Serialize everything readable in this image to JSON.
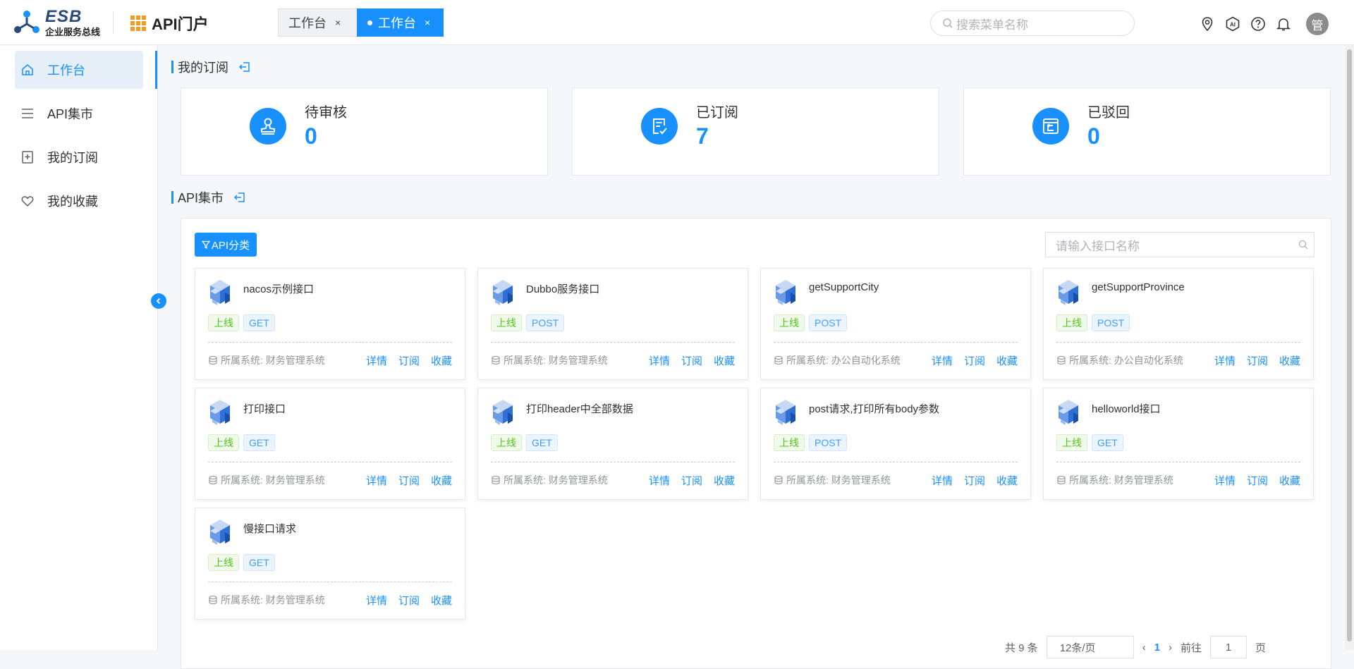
{
  "brand": {
    "logo_title": "ESB",
    "logo_subtitle": "企业服务总线",
    "portal_title": "API门户"
  },
  "tabs": [
    {
      "label": "工作台",
      "active": false
    },
    {
      "label": "工作台",
      "active": true
    }
  ],
  "header": {
    "search_placeholder": "搜索菜单名称",
    "avatar_text": "管",
    "icons": [
      "location-icon",
      "ai-icon",
      "help-icon",
      "bell-icon"
    ]
  },
  "sidebar": {
    "items": [
      {
        "label": "工作台",
        "icon": "home-icon",
        "active": true
      },
      {
        "label": "API集市",
        "icon": "list-icon"
      },
      {
        "label": "我的订阅",
        "icon": "subscription-icon"
      },
      {
        "label": "我的收藏",
        "icon": "heart-icon"
      }
    ]
  },
  "subscription": {
    "title": "我的订阅",
    "stats": [
      {
        "label": "待审核",
        "value": "0",
        "icon": "stamp-icon"
      },
      {
        "label": "已订阅",
        "value": "7",
        "icon": "checklist-icon"
      },
      {
        "label": "已驳回",
        "value": "0",
        "icon": "return-icon"
      }
    ]
  },
  "market": {
    "title": "API集市",
    "category_button": "API分类",
    "search_placeholder": "请输入接口名称",
    "system_prefix": "所属系统: ",
    "actions": {
      "detail": "详情",
      "subscribe": "订阅",
      "favorite": "收藏"
    },
    "cards": [
      {
        "name": "nacos示例接口",
        "status": "上线",
        "method": "GET",
        "system": "财务管理系统"
      },
      {
        "name": "Dubbo服务接口",
        "status": "上线",
        "method": "POST",
        "system": "财务管理系统"
      },
      {
        "name": "getSupportCity",
        "status": "上线",
        "method": "POST",
        "system": "办公自动化系统"
      },
      {
        "name": "getSupportProvince",
        "status": "上线",
        "method": "POST",
        "system": "办公自动化系统"
      },
      {
        "name": "打印接口",
        "status": "上线",
        "method": "GET",
        "system": "财务管理系统"
      },
      {
        "name": "打印header中全部数据",
        "status": "上线",
        "method": "GET",
        "system": "财务管理系统"
      },
      {
        "name": "post请求,打印所有body参数",
        "status": "上线",
        "method": "POST",
        "system": "财务管理系统"
      },
      {
        "name": "helloworld接口",
        "status": "上线",
        "method": "GET",
        "system": "财务管理系统"
      },
      {
        "name": "慢接口请求",
        "status": "上线",
        "method": "GET",
        "system": "财务管理系统"
      }
    ],
    "pagination": {
      "total": "共 9 条",
      "page_size": "12条/页",
      "current": "1",
      "goto_label": "前往",
      "goto_value": "1",
      "page_suffix": "页"
    }
  },
  "colors": {
    "primary": "#1890ff",
    "online_green": "#52c41a",
    "brand_orange": "#f59a23"
  }
}
